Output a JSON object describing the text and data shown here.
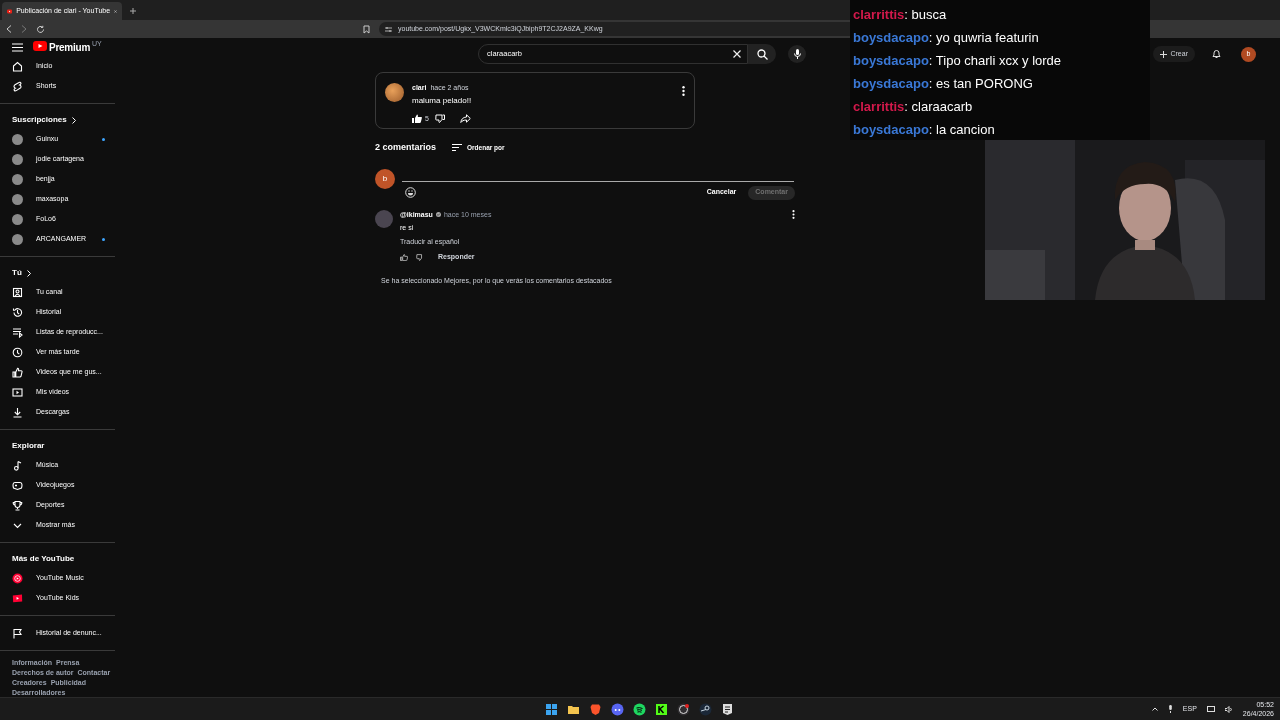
{
  "browser": {
    "tab_title": "Publicación de clari - YouTube",
    "url": "youtube.com/post/Ugkx_V3WCKmlc3iQJbiph9T2CJ2A9ZA_KKwg"
  },
  "header": {
    "logo": "Premium",
    "region": "UY",
    "search": {
      "value": "claraacarb"
    },
    "create": "Crear",
    "avatar": "b"
  },
  "sidebar": [
    {
      "items": [
        {
          "label": "Inicio",
          "kind": "home"
        },
        {
          "label": "Shorts",
          "kind": "shorts"
        }
      ]
    },
    {
      "title": "Suscripciones",
      "chevron": true,
      "items": [
        {
          "label": "Guinxu",
          "kind": "channel",
          "new": true
        },
        {
          "label": "jodie cartagena",
          "kind": "channel",
          "new": false
        },
        {
          "label": "benjja",
          "kind": "channel",
          "new": false
        },
        {
          "label": "maxasopa",
          "kind": "channel",
          "new": false
        },
        {
          "label": "FoLo6",
          "kind": "channel",
          "new": false
        },
        {
          "label": "ARCANGAMER",
          "kind": "channel",
          "new": true
        }
      ]
    },
    {
      "title": "Tú",
      "chevron": true,
      "items": [
        {
          "label": "Tu canal",
          "kind": "person"
        },
        {
          "label": "Historial",
          "kind": "history"
        },
        {
          "label": "Listas de reproducc...",
          "kind": "playlist"
        },
        {
          "label": "Ver más tarde",
          "kind": "clock"
        },
        {
          "label": "Videos que me gus...",
          "kind": "like"
        },
        {
          "label": "Mis videos",
          "kind": "video"
        },
        {
          "label": "Descargas",
          "kind": "download"
        }
      ]
    },
    {
      "title": "Explorar",
      "chevron": false,
      "items": [
        {
          "label": "Música",
          "kind": "music"
        },
        {
          "label": "Videojuegos",
          "kind": "gamepad"
        },
        {
          "label": "Deportes",
          "kind": "trophy"
        },
        {
          "label": "Mostrar más",
          "kind": "chevron"
        }
      ]
    },
    {
      "title": "Más de YouTube",
      "chevron": false,
      "items": [
        {
          "label": "YouTube Music",
          "kind": "ytmusic"
        },
        {
          "label": "YouTube Kids",
          "kind": "ytkids"
        }
      ]
    },
    {
      "items": [
        {
          "label": "Historial de denunc...",
          "kind": "flag"
        }
      ]
    }
  ],
  "footer_links": [
    [
      "Información",
      "Prensa"
    ],
    [
      "Derechos de autor",
      "Contactar"
    ],
    [
      "Creadores",
      "Publicidad"
    ],
    [
      "Desarrolladores"
    ]
  ],
  "post": {
    "author": "clari",
    "time": "hace 2 años",
    "text": "maluma pelado!!",
    "likes": "5"
  },
  "comments_header": {
    "count": "2 comentarios",
    "sort": "Ordenar por"
  },
  "composer": {
    "avatar": "b",
    "cancel": "Cancelar",
    "submit": "Comentar",
    "submit_disabled": true
  },
  "comments": [
    {
      "author": "@ikimasu",
      "verified": true,
      "time": "hace 10 meses",
      "text": "re si",
      "translate": "Traducir al español",
      "reply": "Responder"
    }
  ],
  "notice": "Se ha seleccionado Mejores, por lo que verás los comentarios destacados",
  "chat_separator": ":",
  "chat": [
    {
      "user": "clarrittis",
      "color": "#d2194b",
      "message": "busca"
    },
    {
      "user": "boysdacapo",
      "color": "#3a78d6",
      "message": "yo quwria featurin"
    },
    {
      "user": "boysdacapo",
      "color": "#3a78d6",
      "message": "Tipo charli xcx y lorde"
    },
    {
      "user": "boysdacapo",
      "color": "#3a78d6",
      "message": "es tan PORONG"
    },
    {
      "user": "clarrittis",
      "color": "#d2194b",
      "message": "claraacarb"
    },
    {
      "user": "boysdacapo",
      "color": "#3a78d6",
      "message": "la cancion"
    }
  ],
  "webcam": {
    "kind": "picture"
  },
  "taskbar": {
    "apps": [
      {
        "kind": "windows"
      },
      {
        "kind": "folder"
      },
      {
        "kind": "brave"
      },
      {
        "kind": "discord"
      },
      {
        "kind": "spotify"
      },
      {
        "kind": "kick"
      },
      {
        "kind": "obs"
      },
      {
        "kind": "steam"
      },
      {
        "kind": "epic"
      }
    ],
    "language": "ESP",
    "time": "05:52",
    "date": "26/4/2026"
  }
}
